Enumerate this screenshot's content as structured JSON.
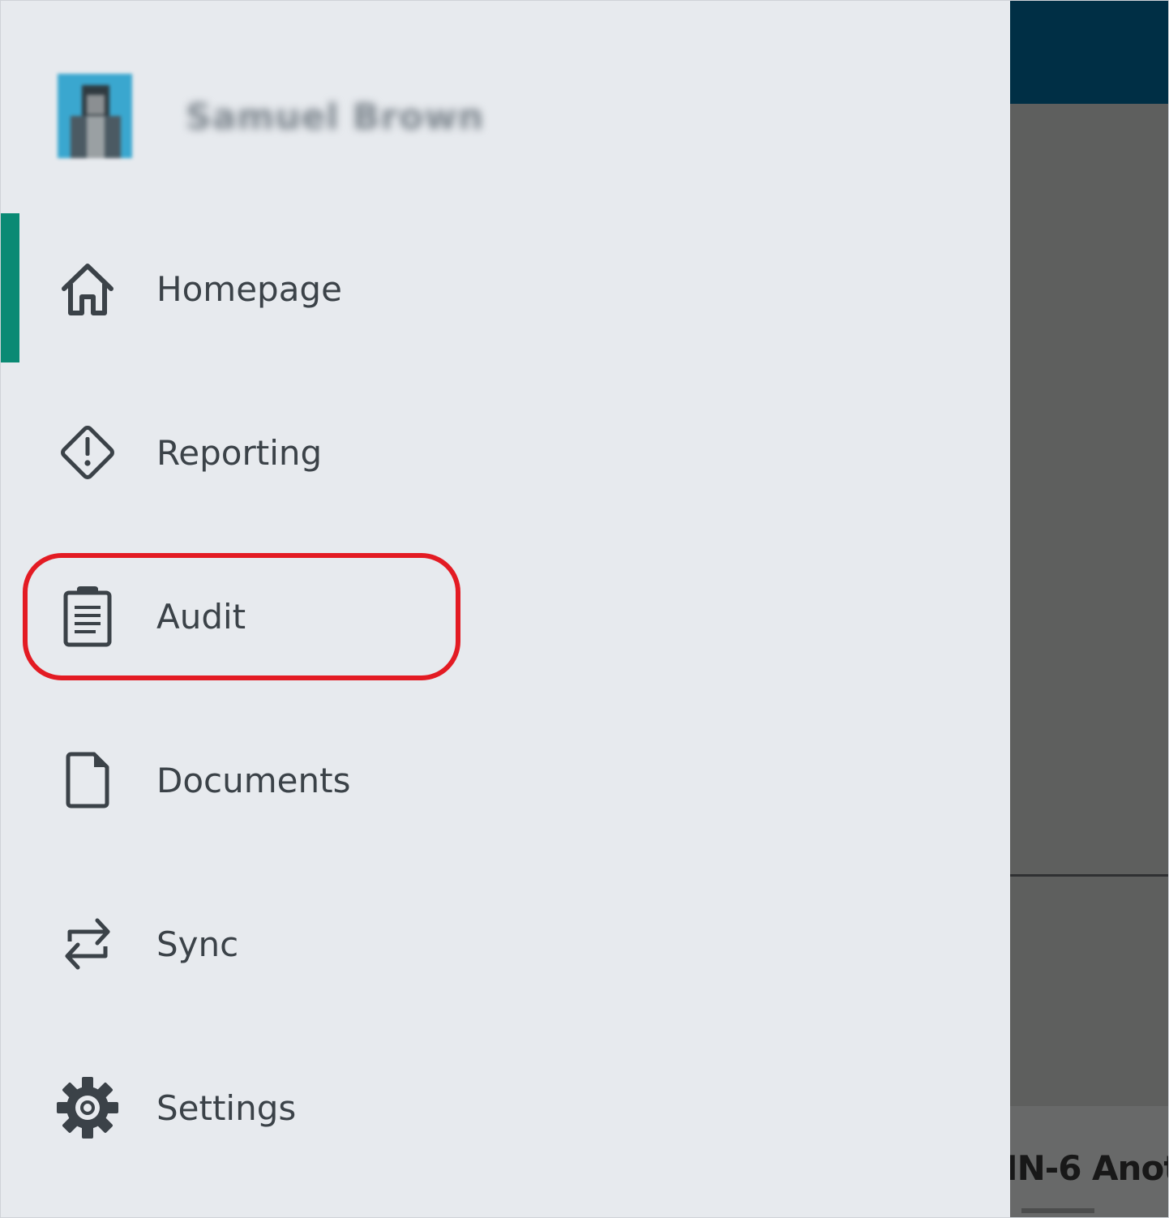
{
  "profile": {
    "name": "Samuel Brown"
  },
  "nav": {
    "items": [
      {
        "label": "Homepage",
        "icon": "home-icon",
        "active": true
      },
      {
        "label": "Reporting",
        "icon": "warning-diamond-icon"
      },
      {
        "label": "Audit",
        "icon": "clipboard-icon",
        "highlighted": true
      },
      {
        "label": "Documents",
        "icon": "document-icon"
      },
      {
        "label": "Sync",
        "icon": "sync-icon"
      },
      {
        "label": "Settings",
        "icon": "gear-icon"
      }
    ]
  },
  "background": {
    "card_title": "IN-6 Anot"
  },
  "colors": {
    "drawer_bg": "#e7eaee",
    "active_indicator": "#0a8a74",
    "highlight_ring": "#e31b23",
    "topbar": "#002f45",
    "overlay": "#5e5f5e",
    "icon_text": "#3b4248"
  }
}
